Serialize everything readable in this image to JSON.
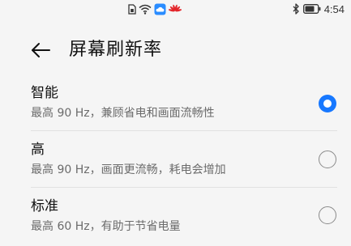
{
  "status_bar": {
    "time": "4:54",
    "left_icons": [
      "sim-card-icon",
      "wifi-icon",
      "cloud-icon",
      "huawei-icon"
    ],
    "right_icons": [
      "bluetooth-icon",
      "battery-icon"
    ]
  },
  "header": {
    "title": "屏幕刷新率",
    "back_icon": "arrow-left-icon"
  },
  "options": [
    {
      "title": "智能",
      "desc": "最高 90 Hz，兼顾省电和画面流畅性",
      "selected": true
    },
    {
      "title": "高",
      "desc": "最高 90 Hz，画面更流畅，耗电会增加",
      "selected": false
    },
    {
      "title": "标准",
      "desc": "最高 60 Hz，有助于节省电量",
      "selected": false
    }
  ],
  "colors": {
    "accent": "#1778ff",
    "background": "#f5f5f5",
    "secondary_text": "#6b6b6b",
    "huawei_red": "#e3262b"
  }
}
